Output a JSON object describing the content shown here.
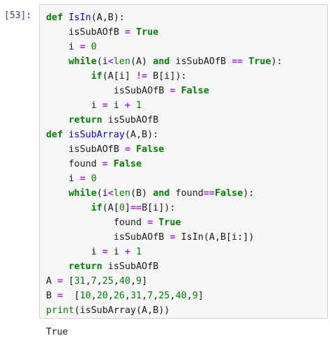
{
  "prompt": "[53]:",
  "code_lines": [
    [
      [
        "kw",
        "def"
      ],
      [
        "t",
        " "
      ],
      [
        "fn",
        "IsIn"
      ],
      [
        "t",
        "(A,B):"
      ]
    ],
    [
      [
        "t",
        "    isSubAOfB "
      ],
      [
        "op",
        "="
      ],
      [
        "t",
        " "
      ],
      [
        "kw",
        "True"
      ]
    ],
    [
      [
        "t",
        "    i "
      ],
      [
        "op",
        "="
      ],
      [
        "t",
        " "
      ],
      [
        "num",
        "0"
      ]
    ],
    [
      [
        "t",
        "    "
      ],
      [
        "kw",
        "while"
      ],
      [
        "t",
        "(i"
      ],
      [
        "op",
        "<"
      ],
      [
        "bi",
        "len"
      ],
      [
        "t",
        "(A) "
      ],
      [
        "kw",
        "and"
      ],
      [
        "t",
        " isSubAOfB "
      ],
      [
        "op",
        "=="
      ],
      [
        "t",
        " "
      ],
      [
        "kw",
        "True"
      ],
      [
        "t",
        "):"
      ]
    ],
    [
      [
        "t",
        "        "
      ],
      [
        "kw",
        "if"
      ],
      [
        "t",
        "(A[i] "
      ],
      [
        "op",
        "!="
      ],
      [
        "t",
        " B[i]):"
      ]
    ],
    [
      [
        "t",
        "            isSubAOfB "
      ],
      [
        "op",
        "="
      ],
      [
        "t",
        " "
      ],
      [
        "kw",
        "False"
      ]
    ],
    [
      [
        "t",
        "        i "
      ],
      [
        "op",
        "="
      ],
      [
        "t",
        " i "
      ],
      [
        "op",
        "+"
      ],
      [
        "t",
        " "
      ],
      [
        "num",
        "1"
      ]
    ],
    [
      [
        "t",
        "    "
      ],
      [
        "kw",
        "return"
      ],
      [
        "t",
        " isSubAOfB"
      ]
    ],
    [
      [
        "kw",
        "def"
      ],
      [
        "t",
        " "
      ],
      [
        "fn",
        "isSubArray"
      ],
      [
        "t",
        "(A,B):"
      ]
    ],
    [
      [
        "t",
        "    isSubAOfB "
      ],
      [
        "op",
        "="
      ],
      [
        "t",
        " "
      ],
      [
        "kw",
        "False"
      ]
    ],
    [
      [
        "t",
        "    found "
      ],
      [
        "op",
        "="
      ],
      [
        "t",
        " "
      ],
      [
        "kw",
        "False"
      ]
    ],
    [
      [
        "t",
        "    i "
      ],
      [
        "op",
        "="
      ],
      [
        "t",
        " "
      ],
      [
        "num",
        "0"
      ]
    ],
    [
      [
        "t",
        "    "
      ],
      [
        "kw",
        "while"
      ],
      [
        "t",
        "(i"
      ],
      [
        "op",
        "<"
      ],
      [
        "bi",
        "len"
      ],
      [
        "t",
        "(B) "
      ],
      [
        "kw",
        "and"
      ],
      [
        "t",
        " found"
      ],
      [
        "op",
        "=="
      ],
      [
        "kw",
        "False"
      ],
      [
        "t",
        "):"
      ]
    ],
    [
      [
        "t",
        "        "
      ],
      [
        "kw",
        "if"
      ],
      [
        "t",
        "(A["
      ],
      [
        "num",
        "0"
      ],
      [
        "t",
        "]"
      ],
      [
        "op",
        "=="
      ],
      [
        "t",
        "B[i]):"
      ]
    ],
    [
      [
        "t",
        "            found "
      ],
      [
        "op",
        "="
      ],
      [
        "t",
        " "
      ],
      [
        "kw",
        "True"
      ]
    ],
    [
      [
        "t",
        "            isSubAOfB "
      ],
      [
        "op",
        "="
      ],
      [
        "t",
        " IsIn(A,B[i:])"
      ]
    ],
    [
      [
        "t",
        "        i "
      ],
      [
        "op",
        "="
      ],
      [
        "t",
        " i "
      ],
      [
        "op",
        "+"
      ],
      [
        "t",
        " "
      ],
      [
        "num",
        "1"
      ]
    ],
    [
      [
        "t",
        "    "
      ],
      [
        "kw",
        "return"
      ],
      [
        "t",
        " isSubAOfB"
      ]
    ],
    [
      [
        "t",
        "A "
      ],
      [
        "op",
        "="
      ],
      [
        "t",
        " ["
      ],
      [
        "num",
        "31"
      ],
      [
        "t",
        ","
      ],
      [
        "num",
        "7"
      ],
      [
        "t",
        ","
      ],
      [
        "num",
        "25"
      ],
      [
        "t",
        ","
      ],
      [
        "num",
        "40"
      ],
      [
        "t",
        ","
      ],
      [
        "num",
        "9"
      ],
      [
        "t",
        "]"
      ]
    ],
    [
      [
        "t",
        "B "
      ],
      [
        "op",
        "="
      ],
      [
        "t",
        "  ["
      ],
      [
        "num",
        "10"
      ],
      [
        "t",
        ","
      ],
      [
        "num",
        "20"
      ],
      [
        "t",
        ","
      ],
      [
        "num",
        "26"
      ],
      [
        "t",
        ","
      ],
      [
        "num",
        "31"
      ],
      [
        "t",
        ","
      ],
      [
        "num",
        "7"
      ],
      [
        "t",
        ","
      ],
      [
        "num",
        "25"
      ],
      [
        "t",
        ","
      ],
      [
        "num",
        "40"
      ],
      [
        "t",
        ","
      ],
      [
        "num",
        "9"
      ],
      [
        "t",
        "]"
      ]
    ],
    [
      [
        "bi",
        "print"
      ],
      [
        "t",
        "(isSubArray(A,B))"
      ]
    ]
  ],
  "output": "True"
}
